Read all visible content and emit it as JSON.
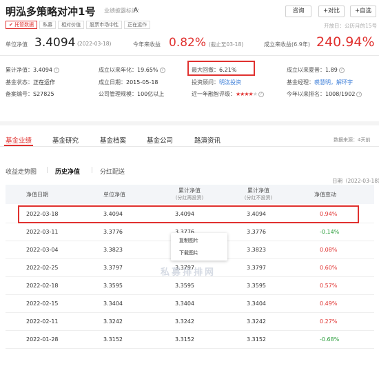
{
  "header": {
    "title": "明泓多策略对冲1号",
    "disclosure_label": "业绩披露标识：",
    "disclosure_value": "A",
    "buttons": {
      "consult": "咨询",
      "compare": "+对比",
      "watchlist": "+自选"
    },
    "tags": [
      "托管数据",
      "私募",
      "相对价值",
      "股票市场中性",
      "正在运作"
    ],
    "open_day": "开放日：公历月的15号"
  },
  "nav_row": {
    "unit_nav_label": "单位净值",
    "unit_nav_value": "3.4094",
    "unit_nav_date": "(2022-03-18)",
    "ytd_label": "今年来收益",
    "ytd_value": "0.82%",
    "ytd_note": "(截止至03-18)",
    "since_label": "成立来收益(6.9年)",
    "since_value": "240.94%"
  },
  "info": {
    "cum_nav_label": "累计净值：",
    "cum_nav_value": "3.4094",
    "annual_label": "成立以来年化：",
    "annual_value": "19.65%",
    "max_dd_label": "最大回撤：",
    "max_dd_value": "6.21%",
    "sharpe_label": "成立以来夏普：",
    "sharpe_value": "1.89",
    "status_label": "基金状态：",
    "status_value": "正在运作",
    "inception_label": "成立日期：",
    "inception_value": "2015-05-18",
    "advisor_label": "投资顾问：",
    "advisor_value": "明汯投资",
    "manager_label": "基金经理：",
    "manager_value": "裘慧明，解环宇",
    "record_label": "备案编号：",
    "record_value": "S27825",
    "scale_label": "公司管理规模：",
    "scale_value": "100亿以上",
    "rating_label": "近一年融智评级：",
    "rank_label": "今年以来排名：",
    "rank_value": "1008/1902"
  },
  "tabs": [
    "基金业绩",
    "基金研究",
    "基金档案",
    "基金公司",
    "路演资讯"
  ],
  "tabs_note": "数据来源：4天前",
  "subtabs": [
    "收益走势图",
    "历史净值",
    "分红配送"
  ],
  "table": {
    "date_tag": "日期（2022-03-18）",
    "headers": {
      "date": "净值日期",
      "unit": "单位净值",
      "cum1": "累计净值",
      "cum1_sub": "(分红再投资)",
      "cum2": "累计净值",
      "cum2_sub": "(分红不投资)",
      "change": "净值变动"
    },
    "rows": [
      {
        "date": "2022-03-18",
        "unit": "3.4094",
        "cum1": "3.4094",
        "cum2": "3.4094",
        "change": "0.94%",
        "dir": "red"
      },
      {
        "date": "2022-03-11",
        "unit": "3.3776",
        "cum1": "3.3776",
        "cum2": "3.3776",
        "change": "-0.14%",
        "dir": "green"
      },
      {
        "date": "2022-03-04",
        "unit": "3.3823",
        "cum1": "3.3823",
        "cum2": "3.3823",
        "change": "0.08%",
        "dir": "red"
      },
      {
        "date": "2022-02-25",
        "unit": "3.3797",
        "cum1": "3.3797",
        "cum2": "3.3797",
        "change": "0.60%",
        "dir": "red"
      },
      {
        "date": "2022-02-18",
        "unit": "3.3595",
        "cum1": "3.3595",
        "cum2": "3.3595",
        "change": "0.57%",
        "dir": "red"
      },
      {
        "date": "2022-02-15",
        "unit": "3.3404",
        "cum1": "3.3404",
        "cum2": "3.3404",
        "change": "0.49%",
        "dir": "red"
      },
      {
        "date": "2022-02-11",
        "unit": "3.3242",
        "cum1": "3.3242",
        "cum2": "3.3242",
        "change": "0.27%",
        "dir": "red"
      },
      {
        "date": "2022-01-28",
        "unit": "3.3152",
        "cum1": "3.3152",
        "cum2": "3.3152",
        "change": "-0.68%",
        "dir": "green"
      }
    ]
  },
  "context_menu": {
    "copy": "复制图片",
    "download": "下载图片"
  },
  "watermark": "私募排排网",
  "colors": {
    "accent": "#e0312f",
    "up": "#e0312f",
    "down": "#2a9d3b",
    "link": "#3b7dd8"
  },
  "rating_stars": 4
}
